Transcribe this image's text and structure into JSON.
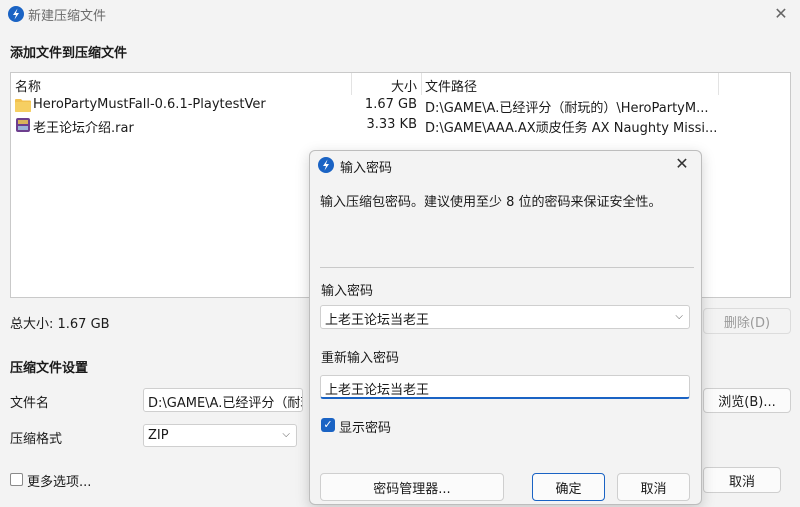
{
  "window": {
    "title": "新建压缩文件",
    "close_icon": "✕"
  },
  "sections": {
    "add_files": "添加文件到压缩文件",
    "settings": "压缩文件设置"
  },
  "file_list": {
    "columns": [
      "名称",
      "大小",
      "文件路径"
    ],
    "rows": [
      {
        "icon": "folder-icon",
        "name": "HeroPartyMustFall-0.6.1-PlaytestVer",
        "size": "1.67 GB",
        "path": "D:\\GAME\\A.已经评分（耐玩的）\\HeroPartyM..."
      },
      {
        "icon": "rar-archive-icon",
        "name": "老王论坛介绍.rar",
        "size": "3.33 KB",
        "path": "D:\\GAME\\AAA.AX顽皮任务 AX Naughty Missi..."
      }
    ]
  },
  "total_size": "总大小: 1.67 GB",
  "buttons": {
    "delete": "删除(D)",
    "browse": "浏览(B)...",
    "cancel_main": "取消"
  },
  "fields": {
    "filename_label": "文件名",
    "filename_value": "D:\\GAME\\A.已经评分（耐玩",
    "format_label": "压缩格式",
    "format_value": "ZIP"
  },
  "more_options": "更多选项...",
  "dialog": {
    "title": "输入密码",
    "close_icon": "✕",
    "description": "输入压缩包密码。建议使用至少 8 位的密码来保证安全性。",
    "password_label": "输入密码",
    "password_value": "上老王论坛当老王",
    "confirm_label": "重新输入密码",
    "confirm_value": "上老王论坛当老王",
    "show_password_label": "显示密码",
    "password_manager": "密码管理器...",
    "ok": "确定",
    "cancel": "取消"
  },
  "colors": {
    "accent": "#1a63c4",
    "folder": "#f2c14e"
  }
}
